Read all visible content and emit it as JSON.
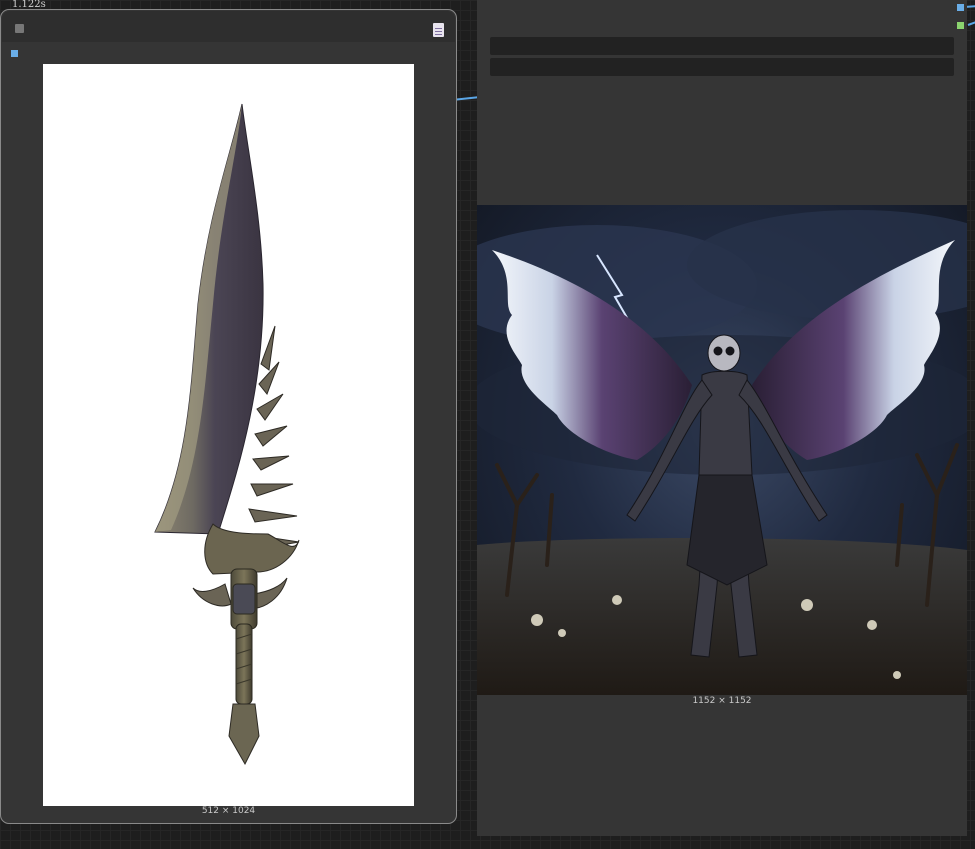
{
  "status": {
    "timing": "1.122s"
  },
  "left_node": {
    "image_alt": "fantasy greatsword with serrated bone spikes on white background",
    "dimensions": "512 × 1024"
  },
  "right_node": {
    "image_alt": "winged skeleton creature standing in a dead forest under a stormy sky",
    "dimensions": "1152 × 1152"
  },
  "colors": {
    "canvas": "#1e1e1e",
    "node_body": "#353535",
    "node_header": "#2e2e2e",
    "link_blue": "#5ba6e6",
    "slot_green": "#8bd36f"
  }
}
